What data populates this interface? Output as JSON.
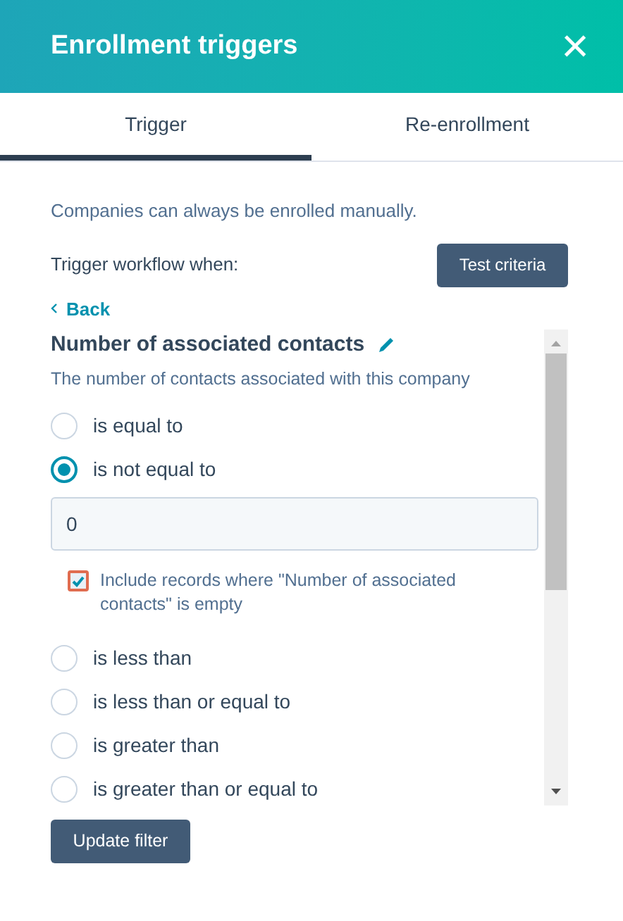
{
  "header": {
    "title": "Enrollment triggers",
    "close": "×"
  },
  "tabs": [
    {
      "label": "Trigger",
      "selected": true
    },
    {
      "label": "Re-enrollment",
      "selected": false
    }
  ],
  "note": "Companies can always be enrolled manually.",
  "trigger_label": "Trigger workflow when:",
  "test_button": "Test criteria",
  "back_link": "Back",
  "filter": {
    "title": "Number of associated contacts",
    "description": "The number of contacts associated with this company",
    "options": [
      {
        "label": "is equal to",
        "selected": false
      },
      {
        "label": "is not equal to",
        "selected": true
      },
      {
        "label": "is less than",
        "selected": false
      },
      {
        "label": "is less than or equal to",
        "selected": false
      },
      {
        "label": "is greater than",
        "selected": false
      },
      {
        "label": "is greater than or equal to",
        "selected": false
      }
    ],
    "value": "0",
    "include_empty": {
      "label": "Include records where \"Number of associated contacts\" is empty",
      "checked": true
    }
  },
  "update_button": "Update filter"
}
